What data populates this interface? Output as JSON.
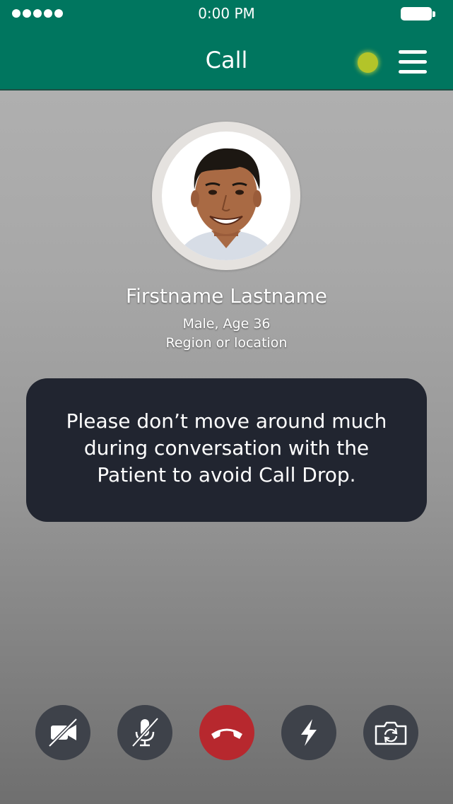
{
  "status_bar": {
    "time": "0:00 PM",
    "signal_icon": "signal-dots-icon",
    "battery_icon": "battery-icon"
  },
  "header": {
    "title": "Call",
    "online_indicator_color": "#b3c429",
    "menu_icon": "hamburger-menu-icon",
    "background_color": "#00765f"
  },
  "patient": {
    "name": "Firstname Lastname",
    "gender_age": "Male, Age 36",
    "location": "Region or location"
  },
  "notice": {
    "line1": "Please don’t move around much",
    "line2": "during conversation with the",
    "line3": "Patient to avoid Call Drop."
  },
  "controls": [
    {
      "icon": "video-off-icon"
    },
    {
      "icon": "mic-off-icon"
    },
    {
      "icon": "end-call-icon",
      "color": "#b7282e"
    },
    {
      "icon": "flash-icon"
    },
    {
      "icon": "switch-camera-icon"
    }
  ]
}
